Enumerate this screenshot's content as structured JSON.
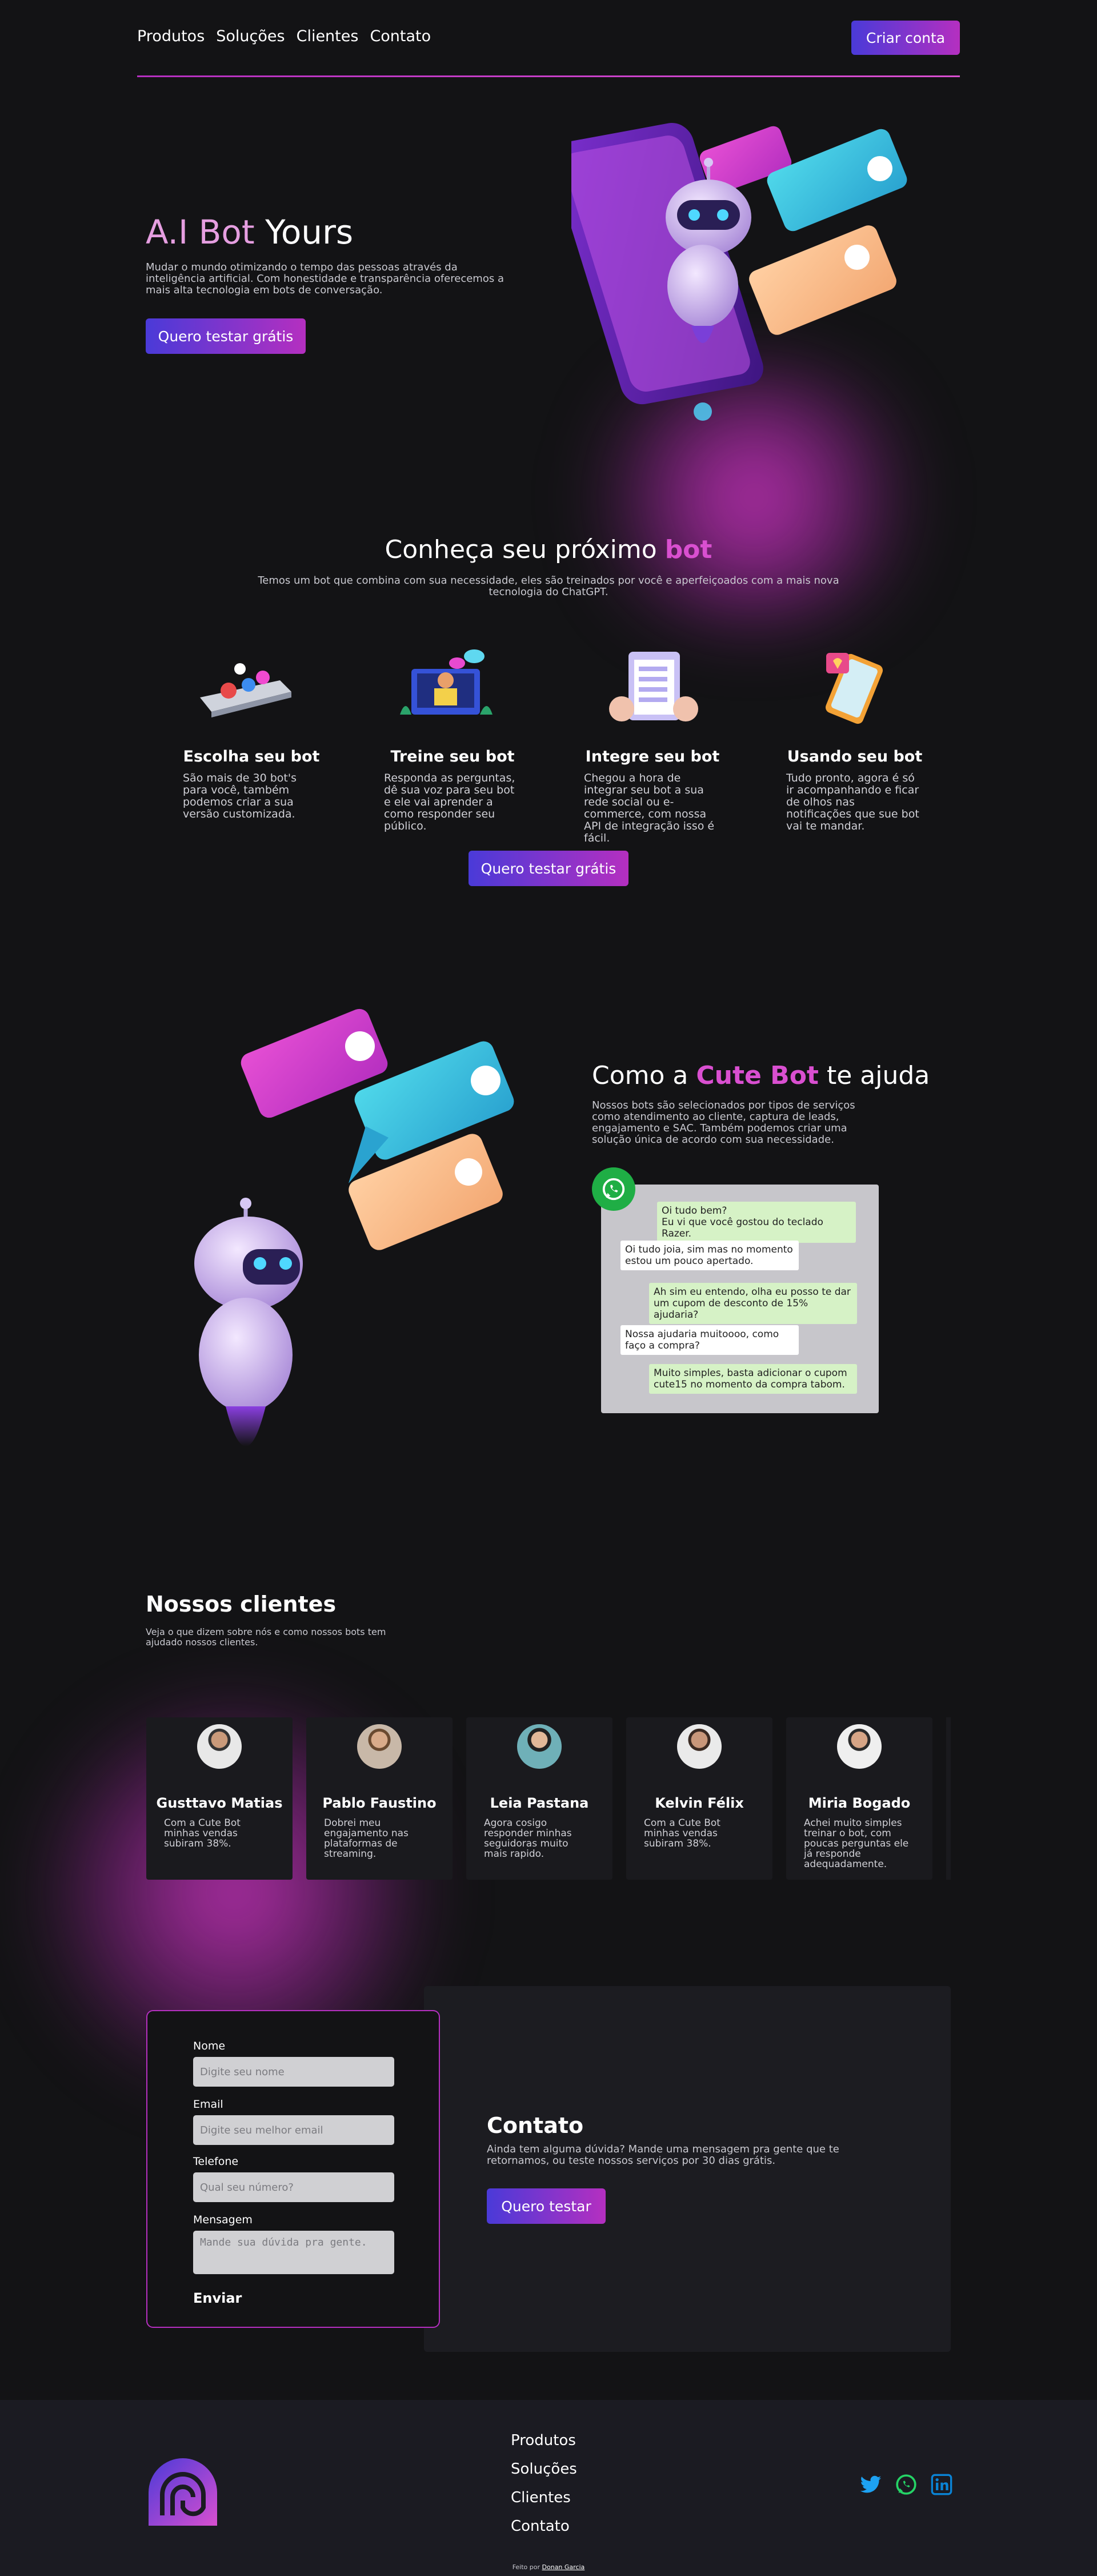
{
  "header": {
    "nav": [
      "Produtos",
      "Soluções",
      "Clientes",
      "Contato"
    ],
    "cta": "Criar conta"
  },
  "hero": {
    "title_pink": "A.I Bot",
    "title_white": " Yours",
    "description": "Mudar o mundo otimizando o tempo das pessoas através da inteligência artificial. Com honestidade e transparência oferecemos a mais alta tecnologia em bots de conversação.",
    "cta": "Quero testar grátis"
  },
  "meet": {
    "title_white": "Conheça seu próximo ",
    "title_pink": "bot",
    "subtitle": "Temos um bot que combina com sua necessidade, eles são treinados por você e aperfeiçoados com a mais nova tecnologia do ChatGPT.",
    "steps": [
      {
        "title": "Escolha seu bot",
        "text": "São mais de 30 bot's para você, também podemos criar a sua versão customizada."
      },
      {
        "title": "Treine seu bot",
        "text": "Responda as perguntas, dê sua voz para seu bot e ele vai aprender a como responder seu público."
      },
      {
        "title": "Integre seu bot",
        "text": "Chegou a hora de integrar seu bot a sua rede social ou e-commerce, com nossa API de integração isso é fácil."
      },
      {
        "title": "Usando seu bot",
        "text": "Tudo pronto, agora é só ir acompanhando e ficar de olhos nas notificações que sue bot vai te mandar."
      }
    ],
    "cta": "Quero testar grátis"
  },
  "help": {
    "title_a": "Como a ",
    "title_pink": "Cute Bot",
    "title_b": " te ajuda",
    "description": "Nossos bots são selecionados por tipos de serviços como atendimento ao cliente, captura de leads, engajamento e SAC. Também podemos criar uma solução única de acordo com sua necessidade.",
    "chat": [
      {
        "side": "out",
        "text": "Oi tudo bem?\nEu vi que você gostou do teclado Razer."
      },
      {
        "side": "in",
        "text": "Oi tudo joia, sim mas no momento estou um pouco apertado."
      },
      {
        "side": "out",
        "text": "Ah sim eu entendo, olha eu posso te dar um cupom de desconto de 15% ajudaria?"
      },
      {
        "side": "in",
        "text": "Nossa ajudaria muitoooo, como faço a compra?"
      },
      {
        "side": "out",
        "text": "Muito simples, basta adicionar o cupom cute15 no momento da compra tabom."
      }
    ]
  },
  "clients": {
    "title": "Nossos clientes",
    "subtitle": "Veja o que dizem sobre nós e como nossos bots tem ajudado nossos clientes.",
    "items": [
      {
        "name": "Gusttavo Matias",
        "text": "Com a Cute Bot minhas vendas subiram 38%."
      },
      {
        "name": "Pablo Faustino",
        "text": "Dobrei meu engajamento nas plataformas de streaming."
      },
      {
        "name": "Leia Pastana",
        "text": "Agora cosigo responder minhas seguidoras muito mais rapido."
      },
      {
        "name": "Kelvin Félix",
        "text": "Com a Cute Bot minhas vendas subiram 38%."
      },
      {
        "name": "Miria Bogado",
        "text": "Achei muito simples treinar o bot, com poucas perguntas ele já responde adequadamente."
      }
    ]
  },
  "form": {
    "name_label": "Nome",
    "name_placeholder": "Digite seu nome",
    "email_label": "Email",
    "email_placeholder": "Digite seu melhor email",
    "phone_label": "Telefone",
    "phone_placeholder": "Qual seu número?",
    "message_label": "Mensagem",
    "message_placeholder": "Mande sua dúvida pra gente.",
    "submit": "Enviar"
  },
  "contact": {
    "title": "Contato",
    "text": "Ainda tem alguma dúvida? Mande uma mensagem pra gente que te retornamos, ou teste nossos serviços por 30 dias grátis.",
    "cta": "Quero testar"
  },
  "footer": {
    "links": [
      "Produtos",
      "Soluções",
      "Clientes",
      "Contato"
    ],
    "credit_prefix": "Feito por ",
    "credit_name": "Donan Garcia",
    "social_icons": [
      "twitter-icon",
      "whatsapp-icon",
      "linkedin-icon"
    ]
  },
  "colors": {
    "background": "#131315",
    "accent_pink": "#d94fd0",
    "accent_blue": "#4a3ad8",
    "card": "#1a1a1e"
  }
}
